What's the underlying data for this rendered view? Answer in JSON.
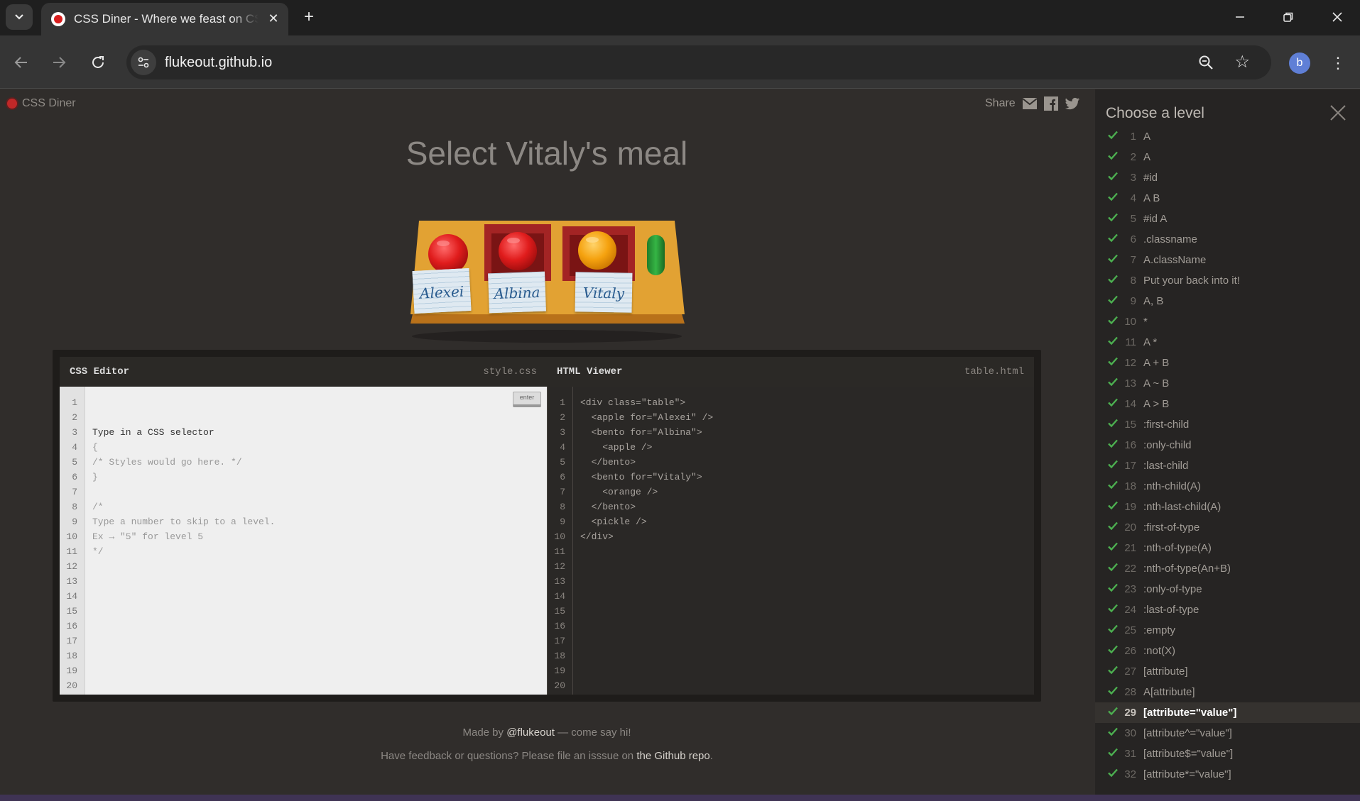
{
  "browser": {
    "tab_title": "CSS Diner - Where we feast on CSS Selectors!",
    "url": "flukeout.github.io",
    "profile_initial": "b",
    "new_tab_symbol": "+"
  },
  "page": {
    "logo_text": "CSS Diner",
    "share_label": "Share",
    "order_title": "Select Vitaly's meal",
    "name_tags": [
      "Alexei",
      "Albina",
      "Vitaly"
    ],
    "css_editor": {
      "title": "CSS Editor",
      "file": "style.css",
      "placeholder": "Type in a CSS selector",
      "enter_label": "enter",
      "lines": [
        "{",
        "/* Styles would go here. */",
        "}",
        "",
        "/*",
        "Type a number to skip to a level.",
        "Ex → \"5\" for level 5",
        "*/"
      ]
    },
    "html_viewer": {
      "title": "HTML Viewer",
      "file": "table.html",
      "lines": [
        "<div class=\"table\">",
        "  <apple for=\"Alexei\" />",
        "  <bento for=\"Albina\">",
        "    <apple />",
        "  </bento>",
        "  <bento for=\"Vitaly\">",
        "    <orange />",
        "  </bento>",
        "  <pickle />",
        "</div>"
      ]
    },
    "line_count": 20,
    "footer": {
      "made_by_prefix": "Made by ",
      "made_by_link": "@flukeout",
      "made_by_suffix": " — come say hi!",
      "feedback_prefix": "Have feedback or questions? Please file an isssue on ",
      "feedback_link": "the Github repo",
      "feedback_suffix": "."
    }
  },
  "sidebar": {
    "title": "Choose a level",
    "current_level": 29,
    "levels": [
      {
        "num": "1",
        "name": "A"
      },
      {
        "num": "2",
        "name": "A"
      },
      {
        "num": "3",
        "name": "#id"
      },
      {
        "num": "4",
        "name": "A  B"
      },
      {
        "num": "5",
        "name": "#id  A"
      },
      {
        "num": "6",
        "name": ".classname"
      },
      {
        "num": "7",
        "name": "A.className"
      },
      {
        "num": "8",
        "name": "Put your back into it!"
      },
      {
        "num": "9",
        "name": "A, B"
      },
      {
        "num": "10",
        "name": "*"
      },
      {
        "num": "11",
        "name": "A  *"
      },
      {
        "num": "12",
        "name": "A + B"
      },
      {
        "num": "13",
        "name": "A ~ B"
      },
      {
        "num": "14",
        "name": "A > B"
      },
      {
        "num": "15",
        "name": ":first-child"
      },
      {
        "num": "16",
        "name": ":only-child"
      },
      {
        "num": "17",
        "name": ":last-child"
      },
      {
        "num": "18",
        "name": ":nth-child(A)"
      },
      {
        "num": "19",
        "name": ":nth-last-child(A)"
      },
      {
        "num": "20",
        "name": ":first-of-type"
      },
      {
        "num": "21",
        "name": ":nth-of-type(A)"
      },
      {
        "num": "22",
        "name": ":nth-of-type(An+B)"
      },
      {
        "num": "23",
        "name": ":only-of-type"
      },
      {
        "num": "24",
        "name": ":last-of-type"
      },
      {
        "num": "25",
        "name": ":empty"
      },
      {
        "num": "26",
        "name": ":not(X)"
      },
      {
        "num": "27",
        "name": "[attribute]"
      },
      {
        "num": "28",
        "name": "A[attribute]"
      },
      {
        "num": "29",
        "name": "[attribute=\"value\"]"
      },
      {
        "num": "30",
        "name": "[attribute^=\"value\"]"
      },
      {
        "num": "31",
        "name": "[attribute$=\"value\"]"
      },
      {
        "num": "32",
        "name": "[attribute*=\"value\"]"
      }
    ]
  },
  "colors": {
    "check": "#4caf50",
    "table_top": "#e2a233",
    "bento": "#8d1d1d",
    "apple": "#d81e1e",
    "orange": "#f0a010",
    "pickle": "#2c9a3a"
  }
}
